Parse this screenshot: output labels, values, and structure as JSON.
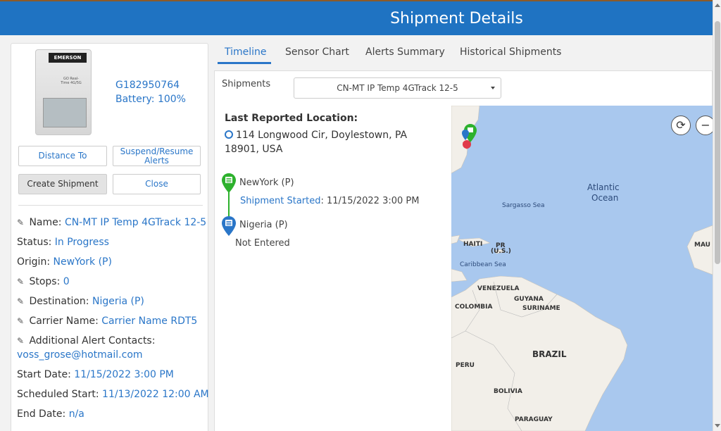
{
  "header": {
    "title": "Shipment Details"
  },
  "device": {
    "id": "G182950764",
    "battery": "Battery: 100%",
    "logo": "EMERSON",
    "model_text": "GO Real-Time 4G/5G"
  },
  "buttons": {
    "distance_to": "Distance To",
    "suspend_resume": "Suspend/Resume Alerts",
    "create_shipment": "Create Shipment",
    "close": "Close"
  },
  "fields": {
    "name_label": "Name:",
    "name_value": "CN-MT IP Temp 4GTrack 12-5",
    "status_label": "Status:",
    "status_value": "In Progress",
    "origin_label": "Origin:",
    "origin_value": "NewYork (P)",
    "stops_label": "Stops:",
    "stops_value": "0",
    "destination_label": "Destination:",
    "destination_value": "Nigeria (P)",
    "carrier_label": "Carrier Name:",
    "carrier_value": "Carrier Name RDT5",
    "alert_contacts_label": "Additional Alert Contacts:",
    "alert_contacts_value": "voss_grose@hotmail.com",
    "start_date_label": "Start Date:",
    "start_date_value": "11/15/2022 3:00 PM",
    "scheduled_start_label": "Scheduled Start:",
    "scheduled_start_value": "11/13/2022 12:00 AM",
    "end_date_label": "End Date:",
    "end_date_value": "n/a"
  },
  "tabs": [
    {
      "label": "Timeline",
      "active": true
    },
    {
      "label": "Sensor Chart",
      "active": false
    },
    {
      "label": "Alerts Summary",
      "active": false
    },
    {
      "label": "Historical Shipments",
      "active": false
    }
  ],
  "shipments": {
    "label": "Shipments",
    "selected": "CN-MT IP Temp 4GTrack 12-5"
  },
  "location": {
    "title": "Last Reported Location:",
    "address": "114 Longwood Cir, Doylestown, PA 18901, USA"
  },
  "timeline": {
    "origin_name": "NewYork (P)",
    "origin_event_label": "Shipment Started",
    "origin_event_time": ": 11/15/2022 3:00 PM",
    "destination_name": "Nigeria (P)",
    "destination_status": "Not Entered",
    "colors": {
      "origin": "#2db12d",
      "destination": "#2a76c8"
    }
  },
  "map": {
    "labels": {
      "atlantic": "Atlantic",
      "ocean": "Ocean",
      "sargasso": "Sargasso Sea",
      "haiti": "HAITI",
      "pr": "PR",
      "us": "(U.S.)",
      "caribbean": "Caribbean Sea",
      "venezuela": "VENEZUELA",
      "guyana": "GUYANA",
      "colombia": "COLOMBIA",
      "suriname": "SURINAME",
      "brazil": "BRAZIL",
      "peru": "PERU",
      "bolivia": "BOLIVIA",
      "paraguay": "PARAGUAY",
      "mau": "MAU"
    }
  },
  "colors": {
    "header": "#1f73c2",
    "accent": "#2a76c8",
    "map_water": "#a9c8ee",
    "map_land": "#f2efe9"
  }
}
